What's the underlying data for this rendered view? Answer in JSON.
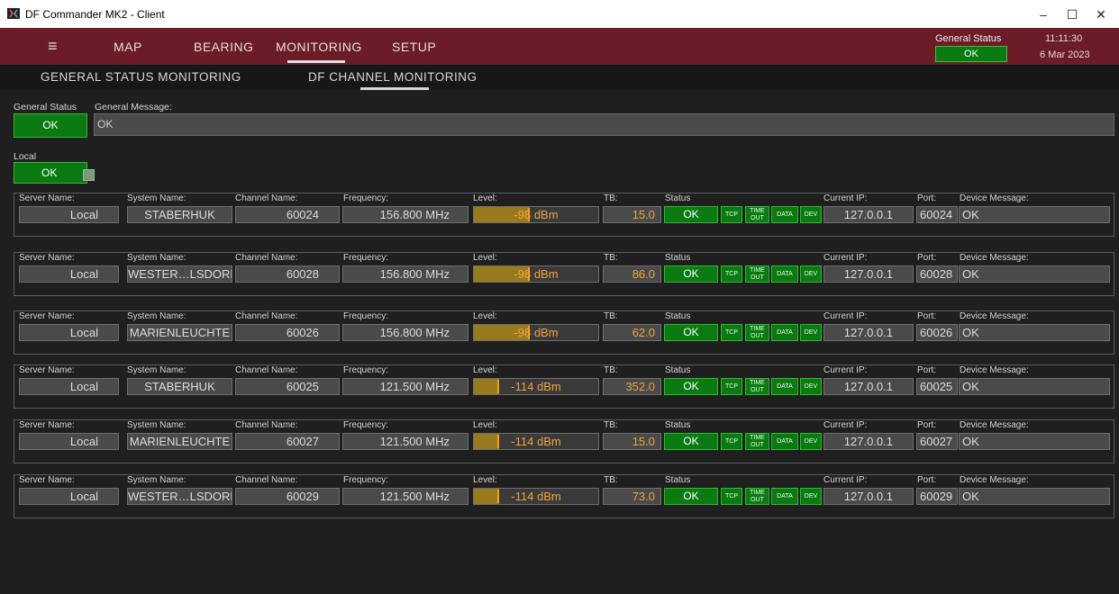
{
  "window": {
    "title": "DF Commander MK2 - Client",
    "minimize": "–",
    "maximize": "☐",
    "close": "✕"
  },
  "menu": {
    "hamburger": "≡",
    "items": [
      "MAP",
      "BEARING",
      "MONITORING",
      "SETUP"
    ],
    "active": "MONITORING"
  },
  "header_status": {
    "label": "General Status",
    "value": "OK",
    "time": "11:11:30",
    "date": "6 Mar 2023"
  },
  "subtabs": [
    "GENERAL STATUS MONITORING",
    "DF CHANNEL MONITORING"
  ],
  "general": {
    "status_label": "General Status",
    "status_value": "OK",
    "message_label": "General Message:",
    "message_value": "OK"
  },
  "local": {
    "label": "Local",
    "value": "OK"
  },
  "field_labels": {
    "server": "Server Name:",
    "system": "System Name:",
    "channel": "Channel Name:",
    "frequency": "Frequency:",
    "level": "Level:",
    "tb": "TB:",
    "status": "Status",
    "ip": "Current IP:",
    "port": "Port:",
    "device": "Device Message:"
  },
  "status_buttons": {
    "tcp": "TCP",
    "time1": "TIME",
    "time2": "OUT",
    "data": "DATA",
    "dev": "DEV"
  },
  "channels": [
    {
      "server": "Local",
      "system": "STABERHUK",
      "channel": "60024",
      "frequency": "156.800 MHz",
      "level": "-98 dBm",
      "level_fraction": 0.45,
      "tb": "15.0",
      "status": "OK",
      "ip": "127.0.0.1",
      "port": "60024",
      "device": "OK"
    },
    {
      "server": "Local",
      "system": "WESTER…LSDORF",
      "channel": "60028",
      "frequency": "156.800 MHz",
      "level": "-98 dBm",
      "level_fraction": 0.45,
      "tb": "86.0",
      "status": "OK",
      "ip": "127.0.0.1",
      "port": "60028",
      "device": "OK"
    },
    {
      "server": "Local",
      "system": "MARIENLEUCHTE",
      "channel": "60026",
      "frequency": "156.800 MHz",
      "level": "-98 dBm",
      "level_fraction": 0.45,
      "tb": "62.0",
      "status": "OK",
      "ip": "127.0.0.1",
      "port": "60026",
      "device": "OK"
    },
    {
      "server": "Local",
      "system": "STABERHUK",
      "channel": "60025",
      "frequency": "121.500 MHz",
      "level": "-114 dBm",
      "level_fraction": 0.2,
      "tb": "352.0",
      "status": "OK",
      "ip": "127.0.0.1",
      "port": "60025",
      "device": "OK"
    },
    {
      "server": "Local",
      "system": "MARIENLEUCHTE",
      "channel": "60027",
      "frequency": "121.500 MHz",
      "level": "-114 dBm",
      "level_fraction": 0.2,
      "tb": "15.0",
      "status": "OK",
      "ip": "127.0.0.1",
      "port": "60027",
      "device": "OK"
    },
    {
      "server": "Local",
      "system": "WESTER…LSDORF",
      "channel": "60029",
      "frequency": "121.500 MHz",
      "level": "-114 dBm",
      "level_fraction": 0.2,
      "tb": "73.0",
      "status": "OK",
      "ip": "127.0.0.1",
      "port": "60029",
      "device": "OK"
    }
  ],
  "colors": {
    "accent": "#6b1c27",
    "ok_green": "#0b7a12",
    "level_orange": "#f0a43a"
  }
}
